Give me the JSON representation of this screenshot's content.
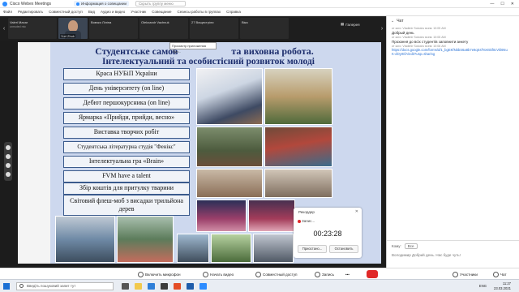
{
  "window": {
    "title": "Cisco Webex Meetings",
    "info_pill": "Информация о совещании",
    "search_placeholder": "Скрыть группу меню"
  },
  "menu": [
    "Файл",
    "Редактировать",
    "Совместный доступ",
    "Вид",
    "Аудио и видео",
    "Участник",
    "Совещание",
    "Сеансы работы в группах",
    "Справка"
  ],
  "participants": [
    {
      "name": "Valeri Maxar",
      "sub": "unmuted mic",
      "video": false
    },
    {
      "name": "Yuri Zhuk",
      "sub": "",
      "video": true
    },
    {
      "name": "Вовчко Ліліна",
      "sub": "",
      "video": false
    },
    {
      "name": "Olekxandr Vachnuk",
      "sub": "",
      "video": false
    },
    {
      "name": "27 Вищестріли",
      "sub": "",
      "video": false
    },
    {
      "name": "Віка",
      "sub": "",
      "video": false
    }
  ],
  "tooltip": "Просмотр приложения 'Пуп...",
  "gallery_label": "Галерея",
  "slide": {
    "title_line1": "Студентське самов",
    "title_line1b": "та виховна  робота.",
    "title_line2": "Інтелектуальний та особистісний розвиток молоді",
    "items": [
      "Краса НУБіП України",
      "День університету (on line)",
      "Дебют першокурсника (on line)",
      "Ярмарка «Прийди, прийди, весно»",
      "Виставка творчих робіт",
      "Студентська літературна студія \"Фенікс\"",
      "Інтелектуальна гра «Brain»",
      "FVM have a talent",
      "Збір коштів для притулку тварини",
      "Світовий флеш-моб з висадки трильйона дерев"
    ]
  },
  "chat": {
    "header": "Чат",
    "messages": [
      {
        "meta": "от кого: Vladimir Sokolov всем: 10:05 AM",
        "text": "Добрый день"
      },
      {
        "meta": "от кого: Vladimir Sokolov всем: 10:05 AM",
        "text": "Прохання до всіх студентів заповнити анкету"
      },
      {
        "meta": "от кого: Vladimir Sokolov всем: 10:06 AM",
        "text": ""
      }
    ],
    "link": "https://docs.google.com/forms/d/1_bgEKfNbbS6a8b7e9qSsfYoK5kf0cVkl6NuK-dOyrEfA/edit?usp=sharing",
    "to_label": "Кому:",
    "to_value": "Все",
    "input_text": "Володимир Добрий день. Нас буде чуть!"
  },
  "recording": {
    "title": "Рекордер",
    "status": "Запис...",
    "time": "00:23:28",
    "pause": "Приостано...",
    "stop": "Остановить"
  },
  "controls": {
    "mute": "Включить микрофон",
    "video": "Начать видео",
    "share": "Совместный доступ",
    "record": "Запись",
    "participants": "Участники",
    "chat": "Чат"
  },
  "taskbar": {
    "search": "Введіть пошуковий запит тут",
    "time": "11:27",
    "date": "23.03.2021",
    "lang": "ENG"
  }
}
